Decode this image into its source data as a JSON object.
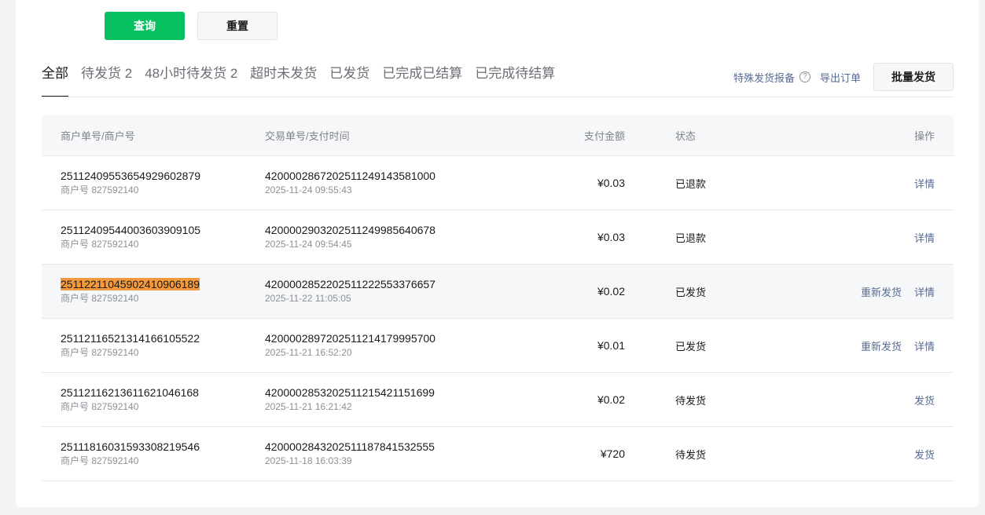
{
  "filters": {
    "query_label": "查询",
    "reset_label": "重置"
  },
  "tabs": [
    {
      "label": "全部",
      "active": true
    },
    {
      "label": "待发货 2",
      "active": false
    },
    {
      "label": "48小时待发货 2",
      "active": false
    },
    {
      "label": "超时未发货",
      "active": false
    },
    {
      "label": "已发货",
      "active": false
    },
    {
      "label": "已完成已结算",
      "active": false
    },
    {
      "label": "已完成待结算",
      "active": false
    }
  ],
  "actions": {
    "special_report": "特殊发货报备",
    "help_icon": "question-circle-icon",
    "export_orders": "导出订单",
    "batch_ship": "批量发货"
  },
  "table": {
    "headers": {
      "merchant": "商户单号/商户号",
      "transaction": "交易单号/支付时间",
      "amount": "支付金额",
      "status": "状态",
      "ops": "操作"
    },
    "rows": [
      {
        "order_no": "2511240955365492960287​9",
        "merchant_id": "商户号 827592140",
        "txn_no": "4200002867202511249143581000",
        "pay_time": "2025-11-24 09:55:43",
        "amount": "¥0.03",
        "status": "已退款",
        "reship": "",
        "action": "详情"
      },
      {
        "order_no": "2511240954400360390910​5",
        "merchant_id": "商户号 827592140",
        "txn_no": "4200002903202511249985640678",
        "pay_time": "2025-11-24 09:54:45",
        "amount": "¥0.03",
        "status": "已退款",
        "reship": "",
        "action": "详情"
      },
      {
        "order_no": "2511221104590241090618​9",
        "merchant_id": "商户号 827592140",
        "txn_no": "4200002852202511222553376657",
        "pay_time": "2025-11-22 11:05:05",
        "amount": "¥0.02",
        "status": "已发货",
        "reship": "重新发货",
        "action": "详情",
        "highlighted": true,
        "hover": true
      },
      {
        "order_no": "2511211652131416610552​2",
        "merchant_id": "商户号 827592140",
        "txn_no": "4200002897202511214179995700",
        "pay_time": "2025-11-21 16:52:20",
        "amount": "¥0.01",
        "status": "已发货",
        "reship": "重新发货",
        "action": "详情"
      },
      {
        "order_no": "2511211621361162104616​8",
        "merchant_id": "商户号 827592140",
        "txn_no": "4200002853202511215421151699",
        "pay_time": "2025-11-21 16:21:42",
        "amount": "¥0.02",
        "status": "待发货",
        "reship": "",
        "action": "发货"
      },
      {
        "order_no": "2511181603159330821954​6",
        "merchant_id": "商户号 827592140",
        "txn_no": "4200002843202511187841532555",
        "pay_time": "2025-11-18 16:03:39",
        "amount": "¥720",
        "status": "待发货",
        "reship": "",
        "action": "发货"
      }
    ]
  },
  "colors": {
    "primary": "#07c160",
    "link": "#576b95",
    "highlight": "#f59a3c"
  }
}
